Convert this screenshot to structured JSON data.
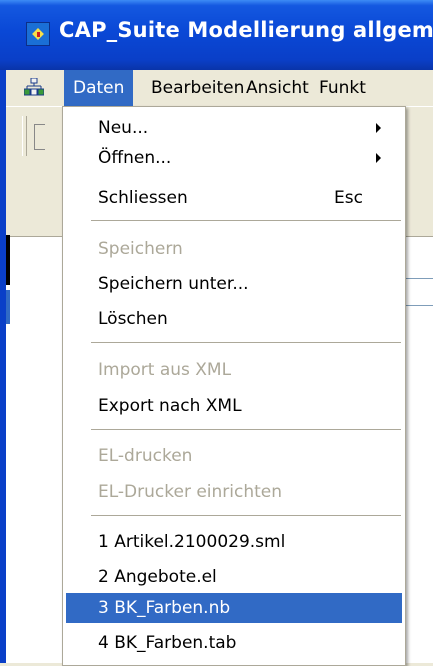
{
  "window": {
    "title": "CAP_Suite Modellierung allgem",
    "icon": "app-icon"
  },
  "menubar": {
    "icon": "tree-structure-icon",
    "items": [
      "Daten",
      "Bearbeiten",
      "Ansicht",
      "Funkt"
    ],
    "active": "Daten"
  },
  "dropdown": {
    "items": [
      {
        "label": "Neu...",
        "submenu": true,
        "enabled": true
      },
      {
        "label": "Öffnen...",
        "submenu": true,
        "enabled": true
      },
      {
        "label": "Schliessen",
        "shortcut": "Esc",
        "enabled": true
      },
      {
        "label": "Speichern",
        "enabled": false
      },
      {
        "label": "Speichern unter...",
        "enabled": true
      },
      {
        "label": "Löschen",
        "enabled": true
      },
      {
        "label": "Import aus XML",
        "enabled": false
      },
      {
        "label": "Export nach XML",
        "enabled": true
      },
      {
        "label": "EL-drucken",
        "enabled": false
      },
      {
        "label": "EL-Drucker einrichten",
        "enabled": false
      },
      {
        "label": "1 Artikel.2100029.sml",
        "enabled": true
      },
      {
        "label": "2 Angebote.el",
        "enabled": true
      },
      {
        "label": "3 BK_Farben.nb",
        "enabled": true,
        "selected": true
      },
      {
        "label": "4 BK_Farben.tab",
        "enabled": true
      }
    ]
  },
  "colors": {
    "titlebar": "#0a3fc8",
    "highlight": "#316ac5",
    "disabled_text": "#aca899",
    "menu_bg": "#ece9d8"
  }
}
